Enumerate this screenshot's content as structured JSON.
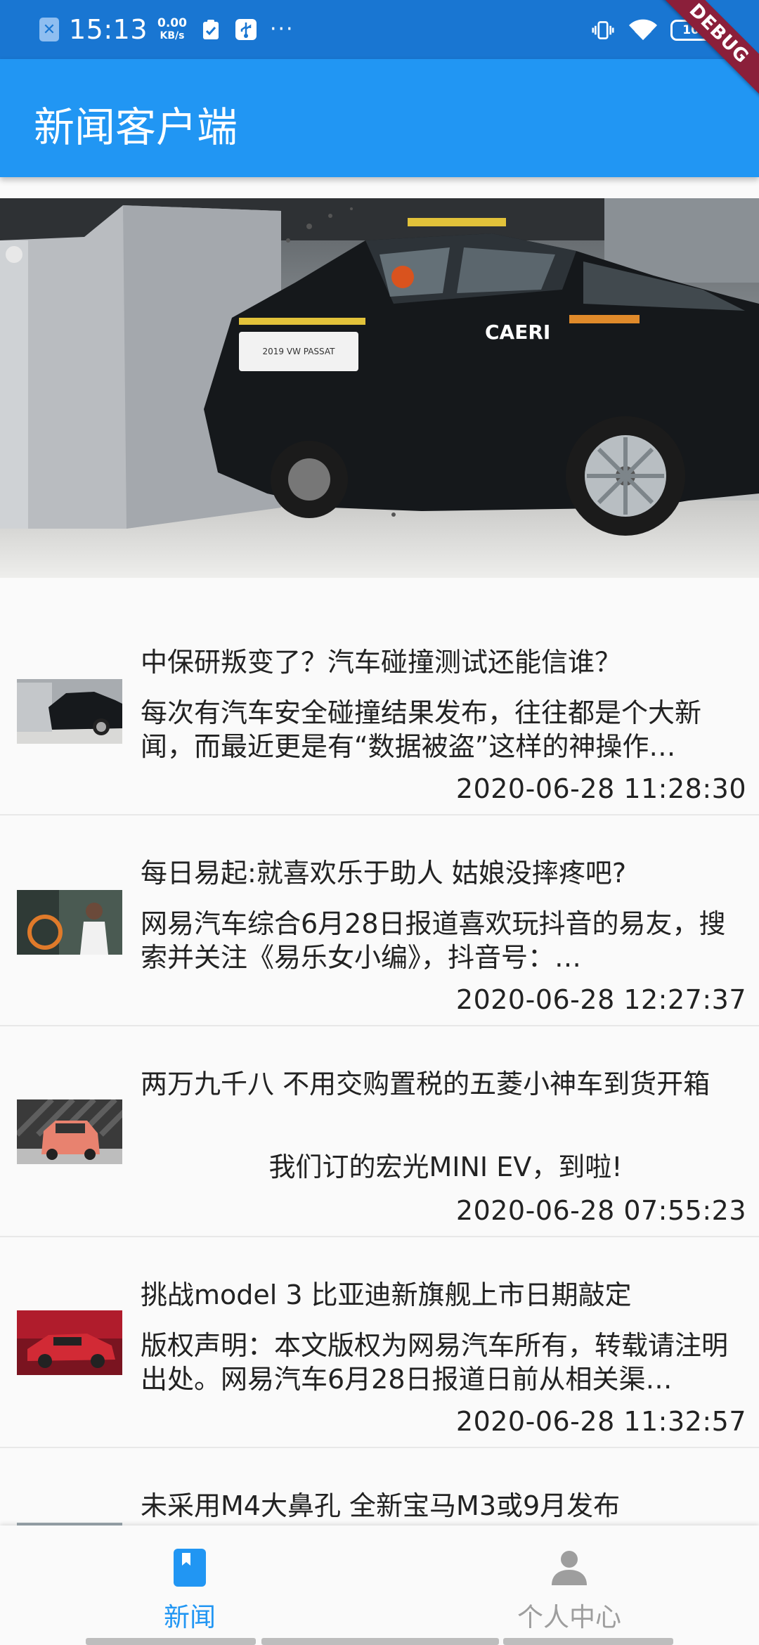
{
  "status_bar": {
    "time": "15:13",
    "net_speed_value": "0.00",
    "net_speed_unit": "KB/s",
    "more": "···",
    "battery": "100"
  },
  "debug_banner": "DEBUG",
  "app_bar": {
    "title": "新闻客户端"
  },
  "news": [
    {
      "title": "中保研叛变了？汽车碰撞测试还能信谁？",
      "summary": "每次有汽车安全碰撞结果发布，往往都是个大新闻，而最近更是有“数据被盗”这样的神操作…",
      "time": "2020-06-28 11:28:30"
    },
    {
      "title": "每日易起:就喜欢乐于助人 姑娘没摔疼吧?",
      "summary": "网易汽车综合6月28日报道喜欢玩抖音的易友，搜索并关注《易乐女小编》，抖音号：…",
      "time": "2020-06-28 12:27:37"
    },
    {
      "title": "两万九千八 不用交购置税的五菱小神车到货开箱",
      "summary": "我们订的宏光MINI EV，到啦!",
      "time": "2020-06-28 07:55:23"
    },
    {
      "title": "挑战model 3 比亚迪新旗舰上市日期敲定",
      "summary": "版权声明：本文版权为网易汽车所有，转载请注明出处。网易汽车6月28日报道日前从相关渠…",
      "time": "2020-06-28 11:32:57"
    },
    {
      "title": "未采用M4大鼻孔 全新宝马M3或9月发布"
    }
  ],
  "bottom_nav": [
    {
      "label": "新闻",
      "icon": "book-icon",
      "active": true
    },
    {
      "label": "个人中心",
      "icon": "person-icon",
      "active": false
    }
  ],
  "colors": {
    "status_bar": "#1976d2",
    "app_bar": "#2196f3",
    "active_tab": "#2196f3",
    "inactive_tab": "#9e9e9e",
    "debug_banner": "#8b1f3a"
  }
}
